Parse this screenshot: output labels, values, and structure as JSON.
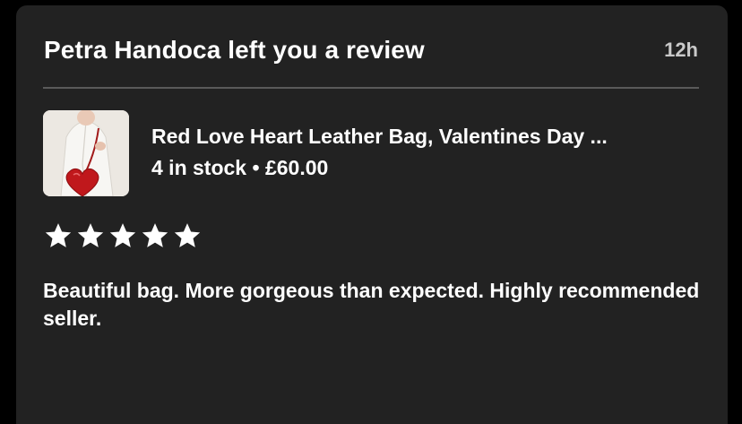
{
  "notification": {
    "title": "Petra Handoca left you a review",
    "time": "12h"
  },
  "product": {
    "title": "Red Love Heart Leather Bag, Valentines Day ...",
    "stock": "4 in stock",
    "separator": "•",
    "price": "£60.00",
    "image_icon": "product-photo-heart-bag"
  },
  "rating": {
    "stars": 5,
    "max": 5
  },
  "review": {
    "text": "Beautiful bag. More gorgeous than expected. Highly recommended seller."
  },
  "colors": {
    "background": "#000000",
    "card": "#222222",
    "text": "#ffffff",
    "muted": "#c9c9c9",
    "star": "#ffffff"
  }
}
